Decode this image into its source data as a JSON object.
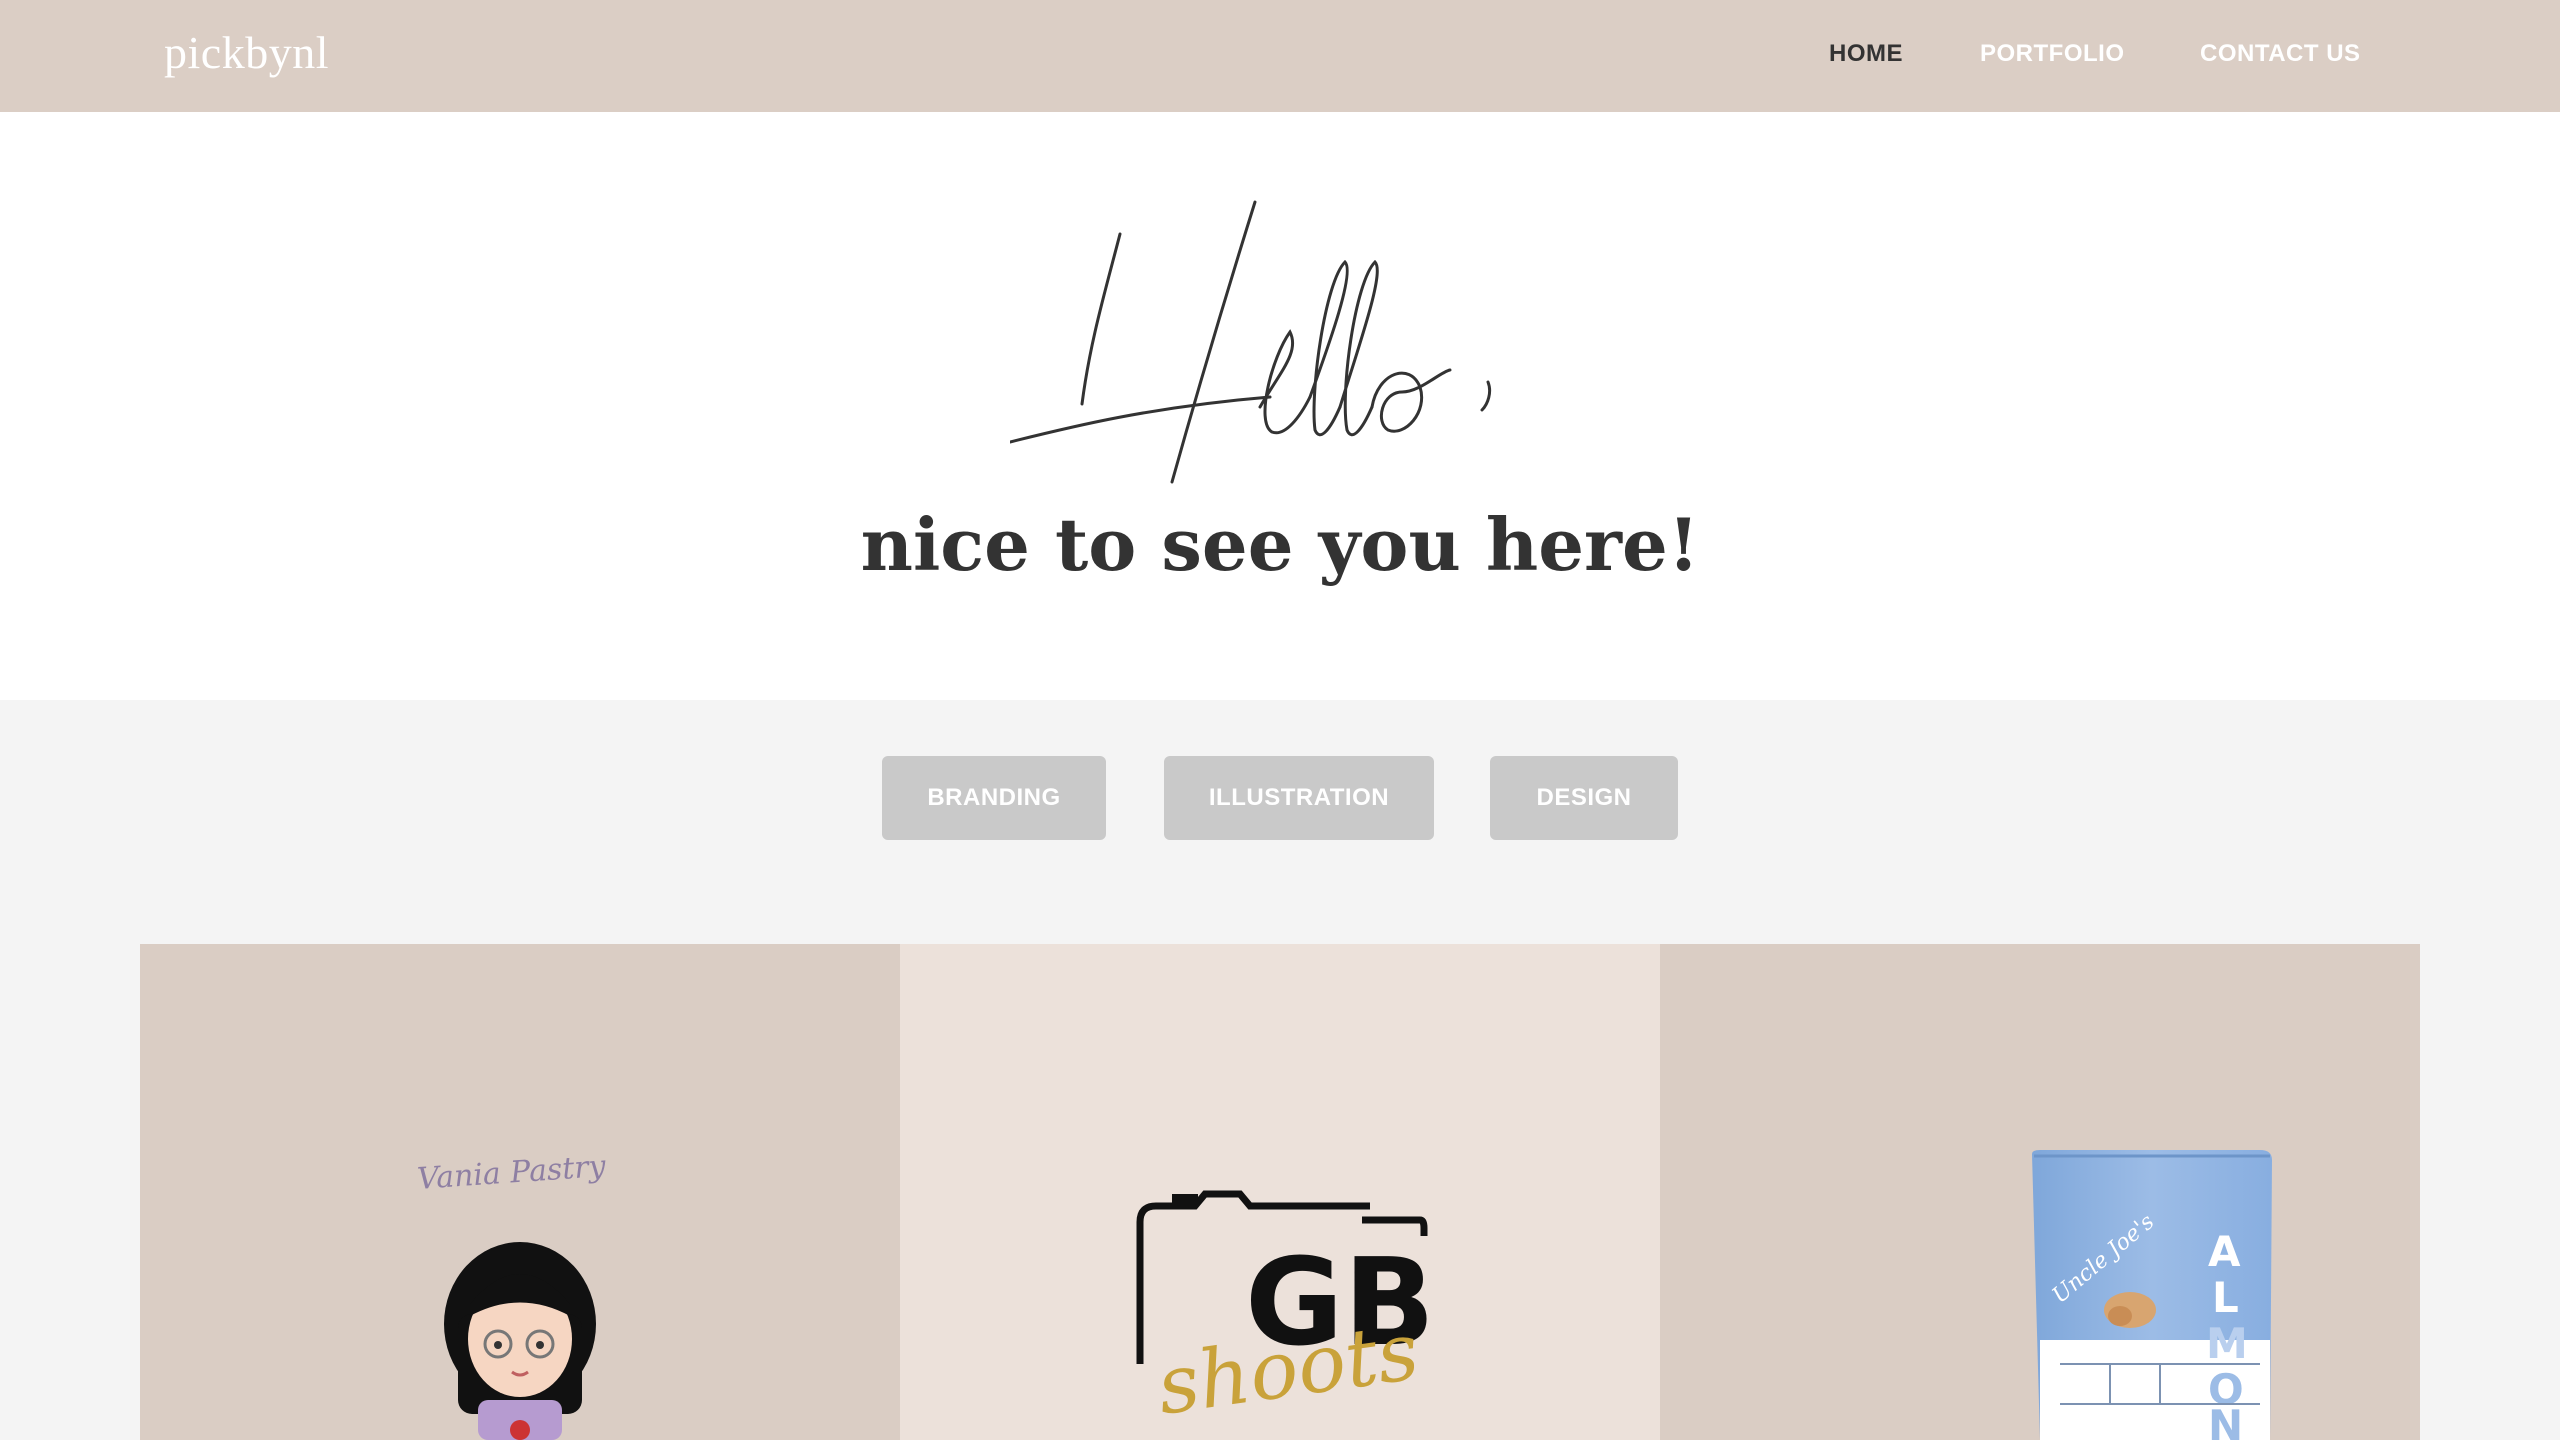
{
  "nav": {
    "brand": "pickbynl",
    "items": [
      {
        "label": "HOME",
        "active": true
      },
      {
        "label": "PORTFOLIO",
        "active": false
      },
      {
        "label": "CONTACT US",
        "active": false
      }
    ]
  },
  "hero": {
    "greeting": "Hello,",
    "subtitle": "nice to see you here!"
  },
  "filters": {
    "buttons": [
      "BRANDING",
      "ILLUSTRATION",
      "DESIGN"
    ]
  },
  "portfolio": {
    "tiles": [
      {
        "logo_text": "Vania Pastry"
      },
      {
        "logo_text": "GB shoots"
      },
      {
        "logo_text": "Uncle Joe's ALMONDS"
      }
    ]
  },
  "colors": {
    "nav_bg": "#dbcec5",
    "filter_button_bg": "#c9c9c9",
    "tile_dark": "#dacdc4",
    "tile_light": "#ece1da",
    "gold": "#c9a23a"
  }
}
